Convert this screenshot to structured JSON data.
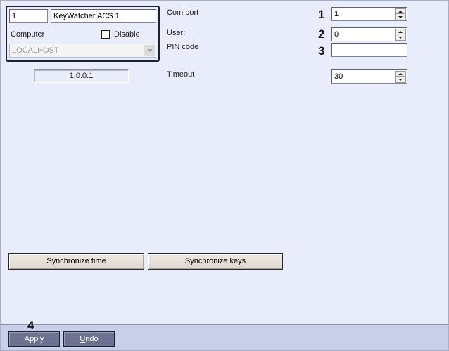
{
  "object": {
    "id": "1",
    "name": "KeyWatcher ACS 1",
    "computer_label": "Computer",
    "disable_label": "Disable",
    "disable_checked": false,
    "computer_value": "LOCALHOST",
    "version": "1.0.0.1"
  },
  "settings": {
    "com_port": {
      "label": "Com port",
      "callout": "1",
      "value": "1"
    },
    "user": {
      "label": "User:",
      "callout": "2",
      "value": "0"
    },
    "pin_code": {
      "label": "PIN code",
      "callout": "3",
      "value": ""
    },
    "timeout": {
      "label": "Timeout",
      "value": "30"
    }
  },
  "actions": {
    "sync_time": "Synchronize time",
    "sync_keys": "Synchronize keys"
  },
  "footer": {
    "callout": "4",
    "apply": "Apply",
    "undo": "Undo"
  }
}
